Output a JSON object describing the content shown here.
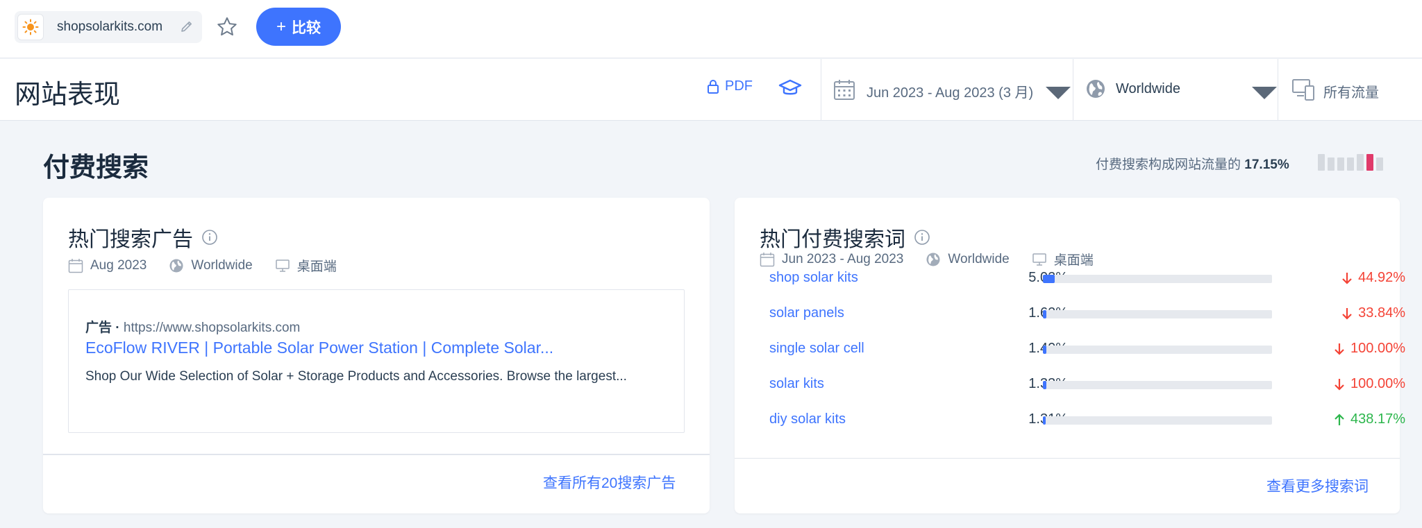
{
  "topbar": {
    "site_name": "shopsolarkits.com",
    "compare_label": "比较"
  },
  "header": {
    "title": "网站表现",
    "pdf_label": "PDF",
    "date_range": "Jun 2023 - Aug 2023 (3 月)",
    "geo": "Worldwide",
    "traffic": "所有流量"
  },
  "section": {
    "title": "付费搜索",
    "share_text": "付费搜索构成网站流量的",
    "share_value": "17.15%",
    "share_bars": [
      0.72,
      0.55,
      0.55,
      0.55,
      0.72,
      0.72,
      0.55
    ],
    "share_bar_highlight_index": 5,
    "accent_color": "#e03a6a"
  },
  "top_ads": {
    "title": "热门搜索广告",
    "date": "Aug 2023",
    "geo": "Worldwide",
    "device": "桌面端",
    "ad": {
      "label": "广告",
      "url": "https://www.shopsolarkits.com",
      "headline": "EcoFlow RIVER | Portable Solar Power Station | Complete Solar...",
      "description": "Shop Our Wide Selection of Solar + Storage Products and Accessories. Browse the largest..."
    },
    "footer_link": "查看所有20搜索广告"
  },
  "top_keywords": {
    "title": "热门付费搜索词",
    "date": "Jun 2023 - Aug 2023",
    "geo": "Worldwide",
    "device": "桌面端",
    "rows": [
      {
        "keyword": "shop solar kits",
        "share": "5.02%",
        "share_value": 5.02,
        "change": "44.92%",
        "direction": "down"
      },
      {
        "keyword": "solar panels",
        "share": "1.62%",
        "share_value": 1.62,
        "change": "33.84%",
        "direction": "down"
      },
      {
        "keyword": "single solar cell",
        "share": "1.40%",
        "share_value": 1.4,
        "change": "100.00%",
        "direction": "down"
      },
      {
        "keyword": "solar kits",
        "share": "1.33%",
        "share_value": 1.33,
        "change": "100.00%",
        "direction": "down"
      },
      {
        "keyword": "diy solar kits",
        "share": "1.31%",
        "share_value": 1.31,
        "change": "438.17%",
        "direction": "up"
      }
    ],
    "footer_link": "查看更多搜索词"
  },
  "colors": {
    "brand_blue": "#3e74fe",
    "down_red": "#f44336",
    "up_green": "#2cb64c"
  }
}
